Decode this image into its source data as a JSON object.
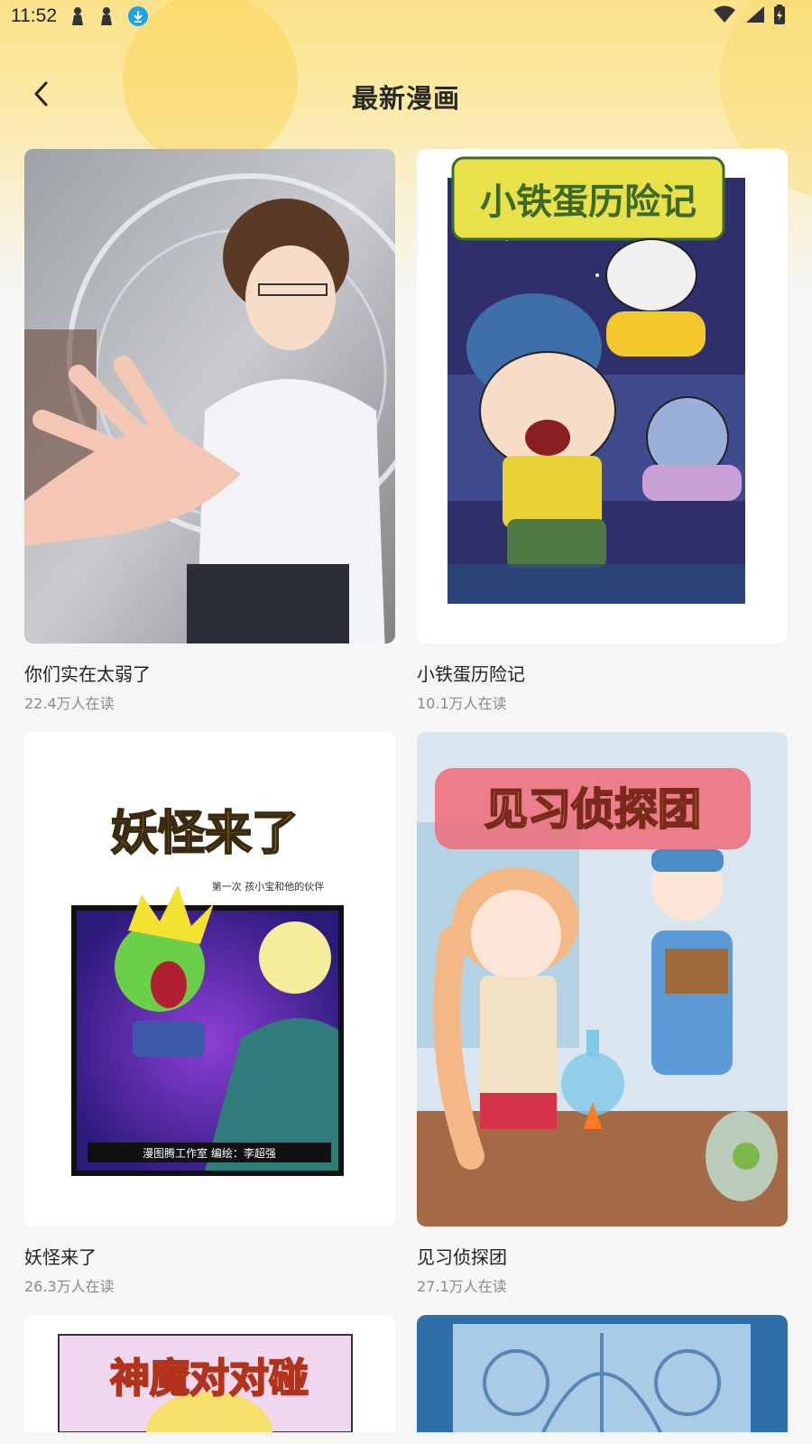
{
  "status_bar": {
    "time": "11:52",
    "icons": [
      "person-icon",
      "person-icon",
      "download-icon",
      "wifi-icon",
      "signal-icon",
      "battery-icon"
    ]
  },
  "header": {
    "title": "最新漫画",
    "back_icon": "chevron-left-icon"
  },
  "comics": [
    {
      "title": "你们实在太弱了",
      "readers": "22.4万人在读"
    },
    {
      "title": "小铁蛋历险记",
      "readers": "10.1万人在读"
    },
    {
      "title": "妖怪来了",
      "readers": "26.3万人在读"
    },
    {
      "title": "见习侦探团",
      "readers": "27.1万人在读"
    }
  ],
  "partial_covers": {
    "left_logo_text": "神魔对对碰"
  },
  "cover_texts": {
    "comic_2_logo": "小铁蛋历险记",
    "comic_3_logo": "妖怪来了",
    "comic_3_subtitle": "第一次 孩小宝和他的伙伴",
    "comic_3_studio": "漫图腾工作室 编绘：李超强",
    "comic_4_logo": "见习侦探团"
  },
  "colors": {
    "header_yellow": "#fbe28a",
    "page_bg": "#f6f6f6",
    "title_text": "#222222",
    "secondary_text": "#8a8a8a"
  }
}
